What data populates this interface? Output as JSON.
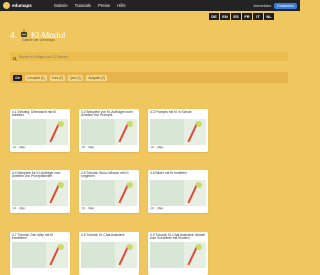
{
  "topbar": {
    "brand": "edumaps",
    "nav": [
      "Galerie",
      "Tutorials",
      "Preise",
      "Hilfe"
    ],
    "login": "Anmelden",
    "register": "Kostenlos"
  },
  "languages": [
    "DE",
    "EN",
    "ES",
    "FR",
    "IT",
    "NL"
  ],
  "page": {
    "number": "4.",
    "title": "KI-Modul",
    "subtitle": "Galerie der Lernmaps"
  },
  "search": {
    "placeholder": "Suche in 9 Maps und 12 Boxen"
  },
  "filters": [
    "Alle",
    "Lernpfad (1)",
    "Kurs (2)",
    "Quiz (1)",
    "Aufgabe (2)"
  ],
  "cards": [
    {
      "title": "4.1 Einstieg: Überwacht mit KI arbeiten",
      "badges": [
        "KI",
        "Map"
      ]
    },
    {
      "title": "4.2 Beispiele von KI-Aufträgen zum Anleiten von Prompts",
      "badges": [
        "KI",
        "Map"
      ]
    },
    {
      "title": "4.3 Prompts mit KI in Schule",
      "badges": [
        "KI",
        "Map"
      ]
    },
    {
      "title": "4.4 Beispiele für KI-Aufträge zum Anleiten von Promptstexten",
      "badges": [
        "KI",
        "Map"
      ]
    },
    {
      "title": "4.5 Tutorial: Wozu Wissen mit KI umgehen",
      "badges": [
        "KI",
        "Map"
      ]
    },
    {
      "title": "4.6 Bilder mit KI erstellen",
      "badges": [
        "KI",
        "Map"
      ]
    },
    {
      "title": "4.7 Tutorial: Gen-Way mit KI erarbeiten",
      "badges": [
        "KI",
        "Map"
      ]
    },
    {
      "title": "4.8 Tutorial: KI-Chat Assistent",
      "badges": [
        "KI",
        "Map"
      ]
    },
    {
      "title": "4.9 Tutorial: KI-Chat Assistent: Aktuell zum Schreiben mit Kindern",
      "badges": [
        "KI",
        "Map"
      ]
    }
  ]
}
